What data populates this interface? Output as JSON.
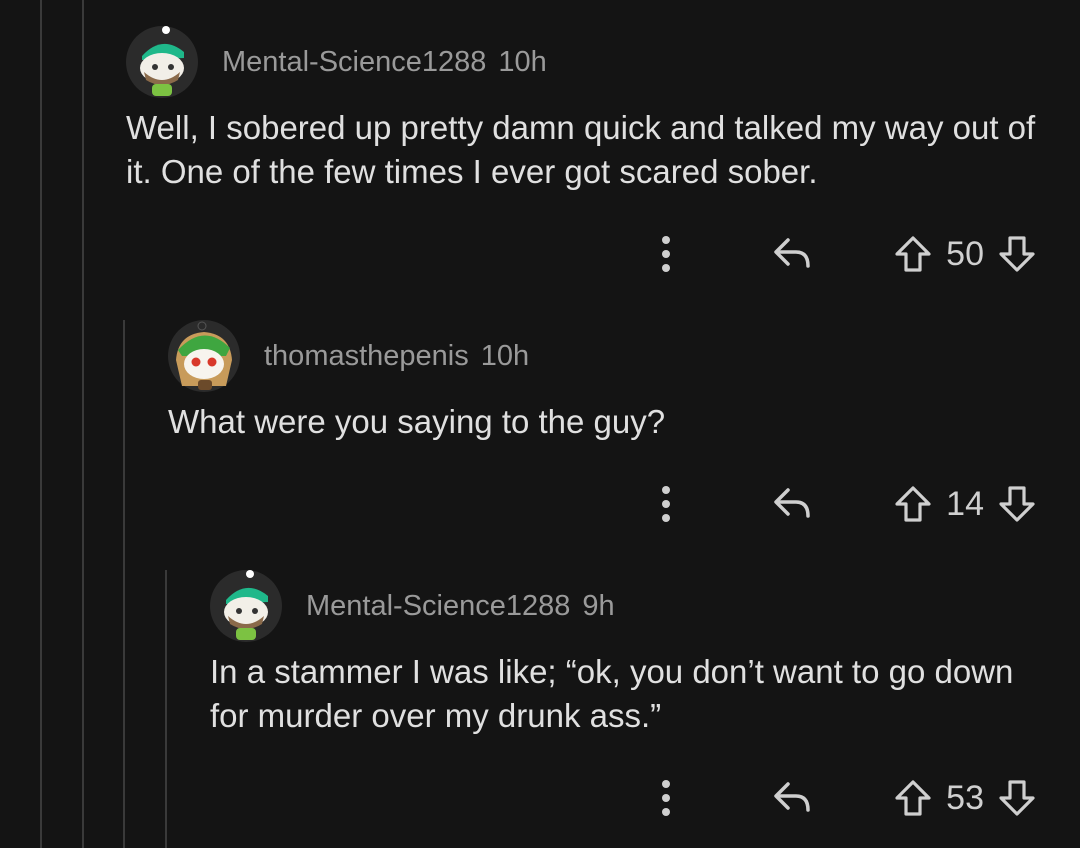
{
  "comments": [
    {
      "username": "Mental-Science1288",
      "time": "10h",
      "text": "Well, I sobered up pretty damn quick and talked my way out of it. One of the few times I ever got scared sober.",
      "score": "50",
      "avatar": "snoo-green-cap-icon"
    },
    {
      "username": "thomasthepenis",
      "time": "10h",
      "text": "What were you saying to the guy?",
      "score": "14",
      "avatar": "snoo-frog-hood-icon"
    },
    {
      "username": "Mental-Science1288",
      "time": "9h",
      "text": "In a stammer I was like; “ok, you don’t want to go down for murder over my drunk ass.”",
      "score": "53",
      "avatar": "snoo-green-cap-icon"
    }
  ],
  "icons": {
    "more": "vertical-dots-icon",
    "reply": "reply-arrow-icon",
    "upvote": "upvote-arrow-icon",
    "downvote": "downvote-arrow-icon"
  },
  "colors": {
    "background": "#141414",
    "thread_line": "#3a3a3a",
    "meta_text": "#9a9a9a",
    "body_text": "#e0e0e0"
  }
}
